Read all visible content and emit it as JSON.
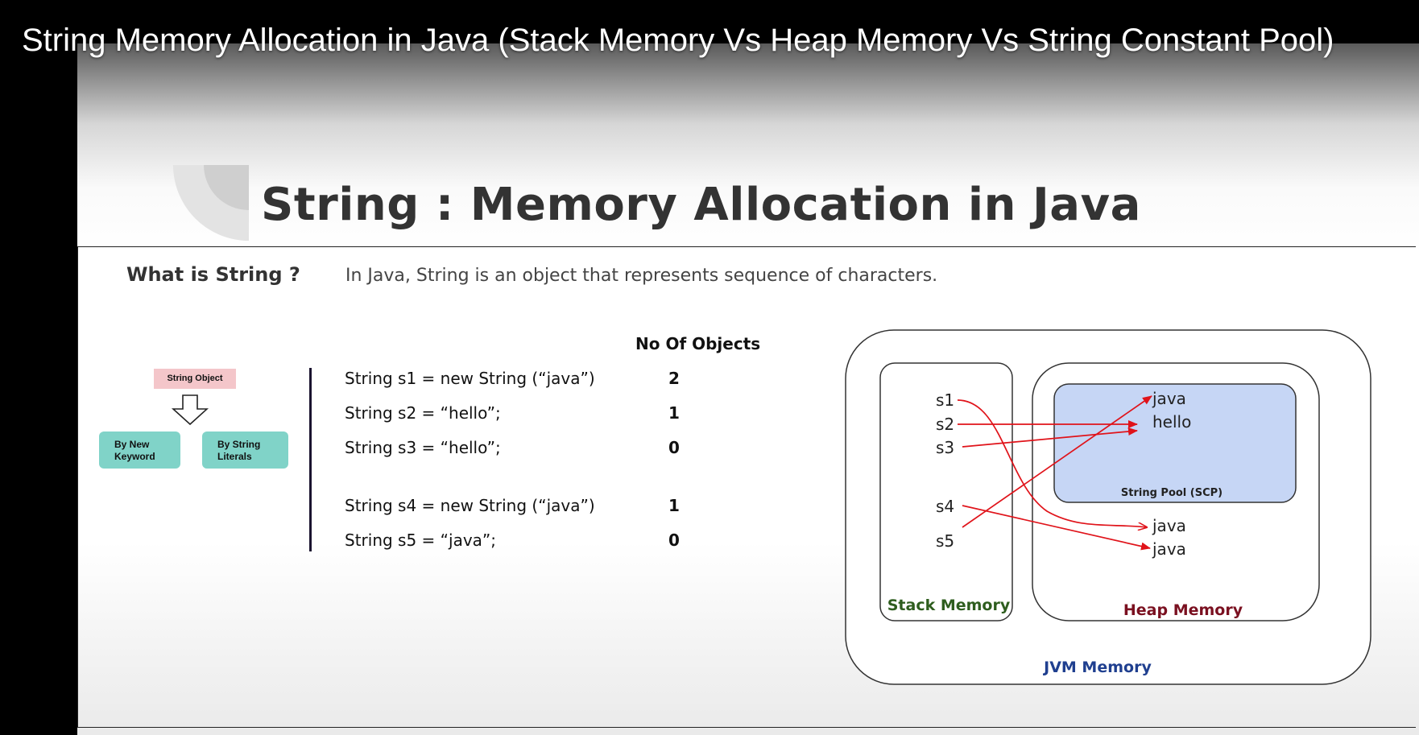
{
  "video_title": "String Memory Allocation in Java (Stack Memory Vs Heap Memory Vs String Constant Pool)",
  "slide": {
    "heading": "String : Memory Allocation in Java",
    "what_label": "What is String ?",
    "definition": "In Java, String is an object that represents sequence of characters."
  },
  "diagram_left": {
    "root": "String Object",
    "left_child": [
      "By New",
      "Keyword"
    ],
    "right_child": [
      "By String",
      "Literals"
    ]
  },
  "code_table": {
    "header": "No Of Objects",
    "rows": [
      {
        "code": "String s1 = new String (“java”)",
        "count": "2"
      },
      {
        "code": "String s2 = “hello”;",
        "count": "1"
      },
      {
        "code": "String s3 = “hello”;",
        "count": "0"
      },
      {
        "code": "String s4 = new String (“java”)",
        "count": "1"
      },
      {
        "code": "String s5 = “java”;",
        "count": "0"
      }
    ]
  },
  "jvm_diagram": {
    "jvm_label": "JVM Memory",
    "stack_label": "Stack Memory",
    "heap_label": "Heap Memory",
    "pool_label": "String Pool (SCP)",
    "stack_vars": [
      "s1",
      "s2",
      "s3",
      "s4",
      "s5"
    ],
    "pool_values": [
      "java",
      "hello"
    ],
    "heap_values": [
      "java",
      "java"
    ],
    "colors": {
      "pool_fill": "#c6d6f5",
      "arrow": "#e0131a",
      "stack_label": "#2e5d1e",
      "heap_label": "#7a1020",
      "jvm_label": "#1f3f8f"
    }
  }
}
